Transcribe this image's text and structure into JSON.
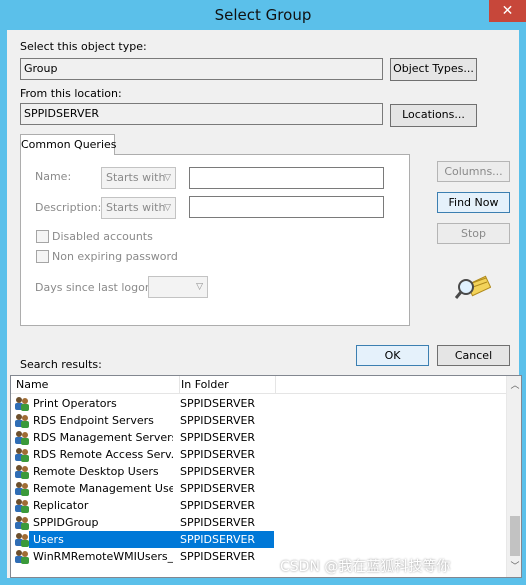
{
  "window": {
    "title": "Select Group",
    "close_glyph": "✕"
  },
  "object_type": {
    "label": "Select this object type:",
    "value": "Group",
    "button": "Object Types..."
  },
  "location": {
    "label": "From this location:",
    "value": "SPPIDSERVER",
    "button": "Locations..."
  },
  "queries": {
    "tab": "Common Queries",
    "name_label": "Name:",
    "name_mode": "Starts with",
    "desc_label": "Description:",
    "desc_mode": "Starts with",
    "disabled_accounts": "Disabled accounts",
    "non_expiring": "Non expiring password",
    "days_label": "Days since last logon:"
  },
  "side_buttons": {
    "columns": "Columns...",
    "find_now": "Find Now",
    "stop": "Stop"
  },
  "ok": "OK",
  "cancel": "Cancel",
  "results": {
    "label": "Search results:",
    "col_name": "Name",
    "col_folder": "In Folder",
    "rows": [
      {
        "name": "Print Operators",
        "folder": "SPPIDSERVER",
        "selected": false
      },
      {
        "name": "RDS Endpoint Servers",
        "folder": "SPPIDSERVER",
        "selected": false
      },
      {
        "name": "RDS Management Servers",
        "folder": "SPPIDSERVER",
        "selected": false
      },
      {
        "name": "RDS Remote Access Serv...",
        "folder": "SPPIDSERVER",
        "selected": false
      },
      {
        "name": "Remote Desktop Users",
        "folder": "SPPIDSERVER",
        "selected": false
      },
      {
        "name": "Remote Management Users",
        "folder": "SPPIDSERVER",
        "selected": false
      },
      {
        "name": "Replicator",
        "folder": "SPPIDSERVER",
        "selected": false
      },
      {
        "name": "SPPIDGroup",
        "folder": "SPPIDSERVER",
        "selected": false
      },
      {
        "name": "Users",
        "folder": "SPPIDSERVER",
        "selected": true
      },
      {
        "name": "WinRMRemoteWMIUsers__",
        "folder": "SPPIDSERVER",
        "selected": false
      }
    ]
  },
  "watermark": "CSDN @我在蓝狐科技等你",
  "icons": {
    "group": "users-group-icon",
    "search": "search-magnifier-icon"
  }
}
